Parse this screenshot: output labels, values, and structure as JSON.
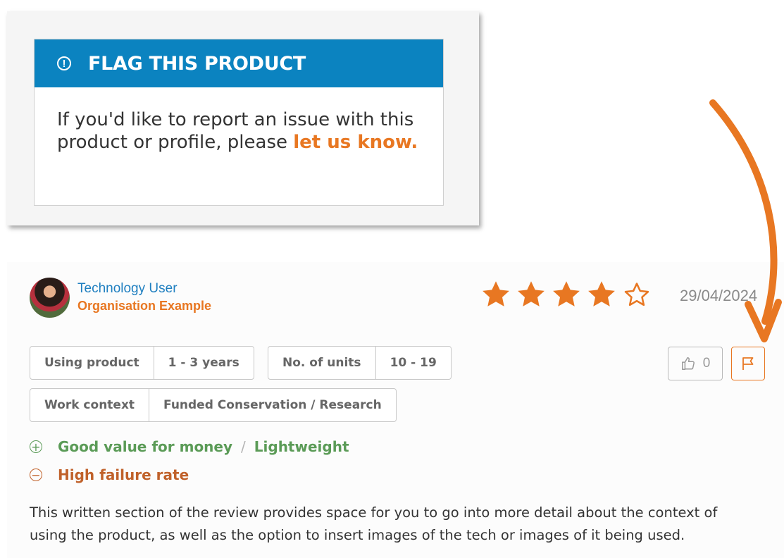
{
  "flag_panel": {
    "title": "FLAG THIS PRODUCT",
    "body_text": "If you'd like to report an issue with this product or profile, please ",
    "link_text": "let us know."
  },
  "review": {
    "user_name": "Technology User",
    "organisation": "Organisation Example",
    "rating": 4,
    "max_rating": 5,
    "date": "29/04/2024",
    "tags": [
      {
        "label": "Using product",
        "value": "1 - 3 years"
      },
      {
        "label": "No. of units",
        "value": "10 - 19"
      },
      {
        "label": "Work context",
        "value": "Funded Conservation / Research"
      }
    ],
    "likes": "0",
    "pros": [
      "Good value for money",
      "Lightweight"
    ],
    "pros_separator": "/",
    "cons": [
      "High failure rate"
    ],
    "description": "This written section of the review provides space for you to go into more detail about the context of using the product, as well as the option to insert images of the tech or images of it being used."
  },
  "colors": {
    "header_blue": "#0b83c0",
    "accent_orange": "#e87722",
    "pro_green": "#5b9b57",
    "con_orange": "#c0612a",
    "user_blue": "#1f7fc0"
  },
  "icons": [
    "info-icon",
    "star-icon",
    "thumbs-up-icon",
    "flag-icon",
    "plus-circle-icon",
    "minus-circle-icon",
    "arrow-annotation"
  ]
}
